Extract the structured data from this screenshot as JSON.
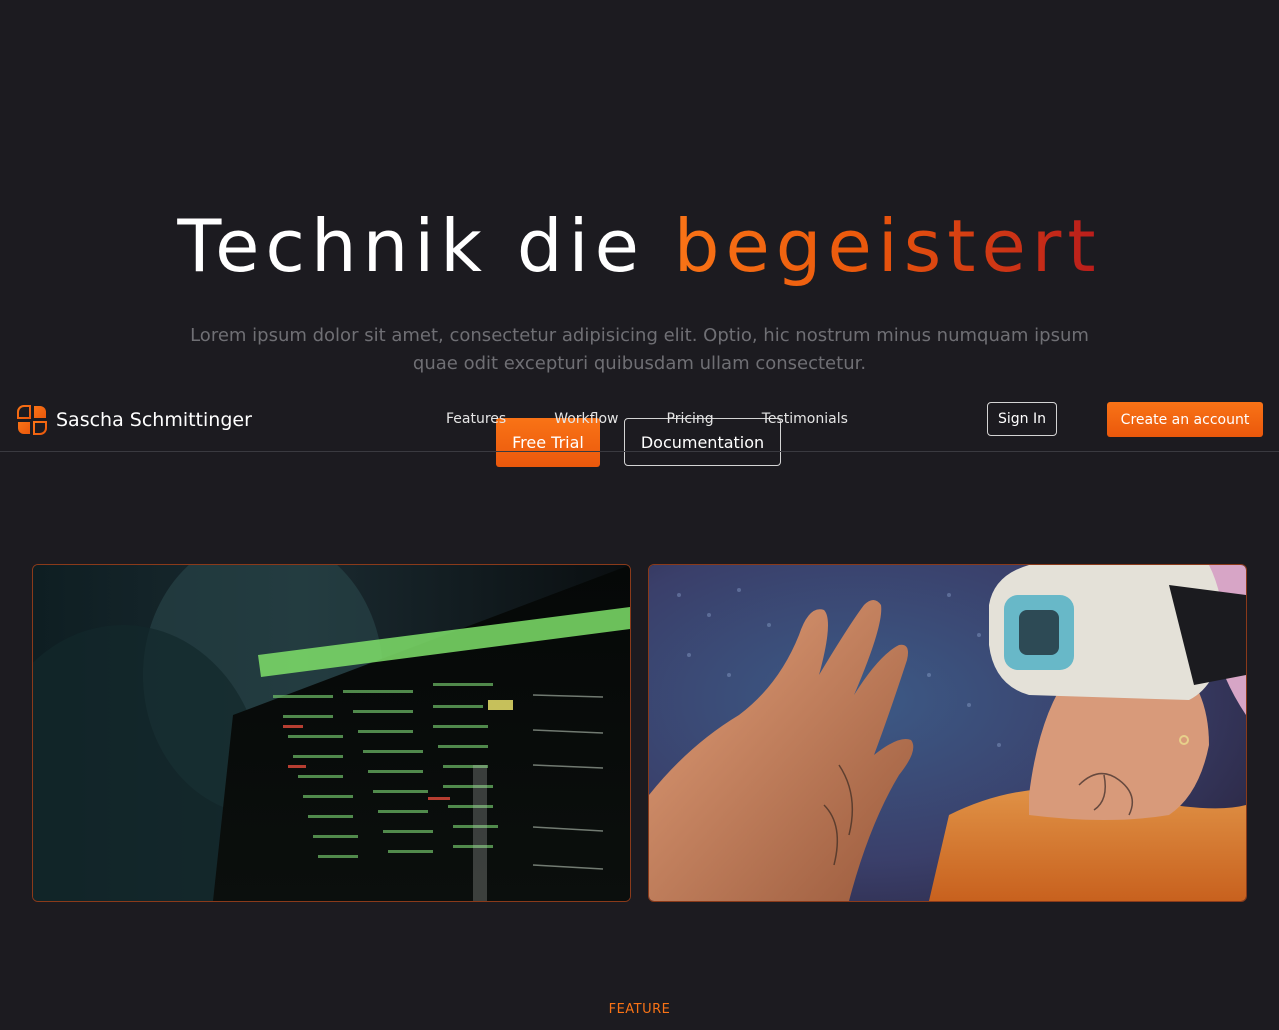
{
  "hero": {
    "title_plain": "Technik die",
    "title_accent": "begeistert",
    "subtitle": "Lorem ipsum dolor sit amet, consectetur adipisicing elit. Optio, hic nostrum minus numquam ipsum quae odit excepturi quibusdam ullam consectetur.",
    "cta_primary": "Free Trial",
    "cta_secondary": "Documentation"
  },
  "nav": {
    "brand": "Sascha Schmittinger",
    "links": [
      "Features",
      "Workflow",
      "Pricing",
      "Testimonials"
    ],
    "sign_in": "Sign In",
    "create_account": "Create an account"
  },
  "images": {
    "left_icon": "terminal-code-photo",
    "right_icon": "vr-headset-photo"
  },
  "section": {
    "feature_label": "FEATURE"
  },
  "colors": {
    "background": "#1c1b20",
    "accent": "#f97316",
    "accent_dark": "#b91c1c",
    "muted_text": "#6f6f74"
  }
}
